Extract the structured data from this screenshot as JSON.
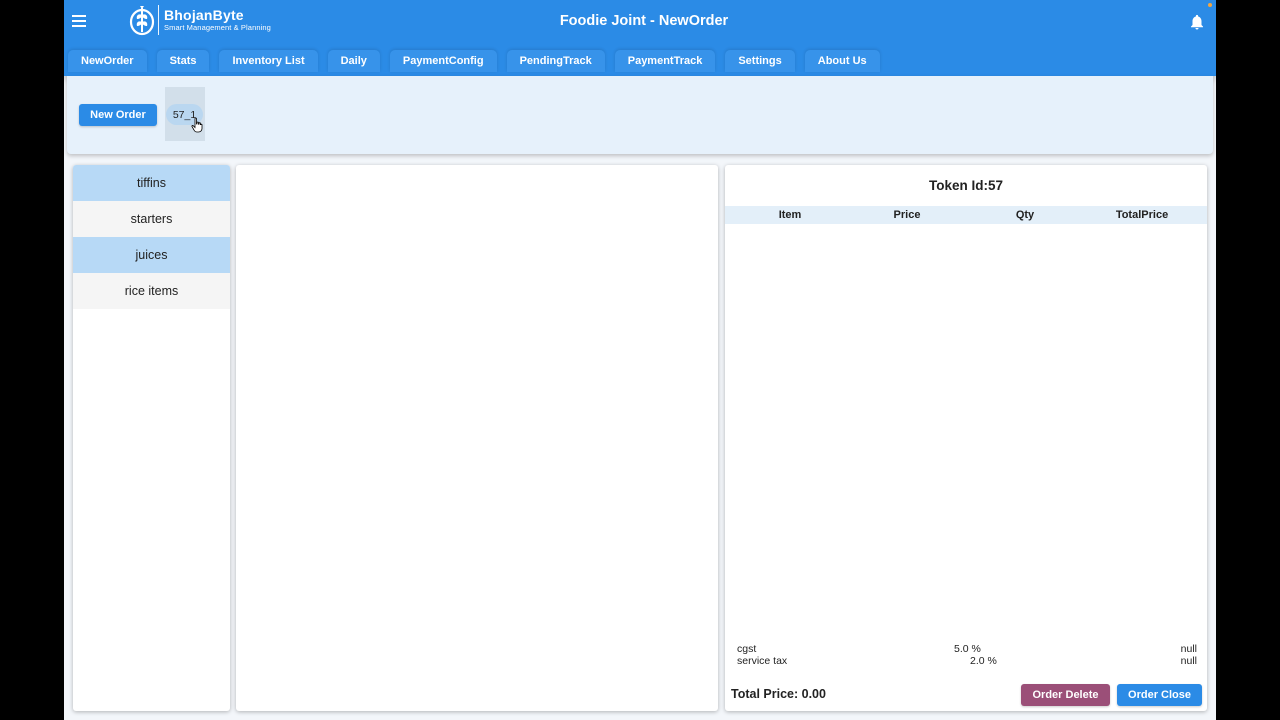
{
  "header": {
    "title": "Foodie Joint - NewOrder",
    "logo_title": "BhojanByte",
    "logo_tagline": "Smart Management & Planning",
    "accent_color": "#2b8be6",
    "menu_icon": "hamburger-menu-icon",
    "bell_icon": "notification-bell-icon"
  },
  "tabs": [
    {
      "label": "NewOrder"
    },
    {
      "label": "Stats"
    },
    {
      "label": "Inventory List"
    },
    {
      "label": "Daily"
    },
    {
      "label": "PaymentConfig"
    },
    {
      "label": "PendingTrack"
    },
    {
      "label": "PaymentTrack"
    },
    {
      "label": "Settings"
    },
    {
      "label": "About Us"
    }
  ],
  "orders": {
    "new_order_label": "New Order",
    "token_chip": "57_1"
  },
  "categories": [
    {
      "label": "tiffins"
    },
    {
      "label": "starters"
    },
    {
      "label": "juices"
    },
    {
      "label": "rice items"
    }
  ],
  "bill": {
    "title": "Token Id:57",
    "columns": {
      "item": "Item",
      "price": "Price",
      "qty": "Qty",
      "total": "TotalPrice"
    },
    "taxes": [
      {
        "name": "cgst",
        "rate": "5.0 %",
        "amount": "null"
      },
      {
        "name": "service tax",
        "rate": "2.0 %",
        "amount": "null"
      }
    ],
    "total_label": "Total Price: 0.00",
    "delete_label": "Order Delete",
    "close_label": "Order Close"
  }
}
